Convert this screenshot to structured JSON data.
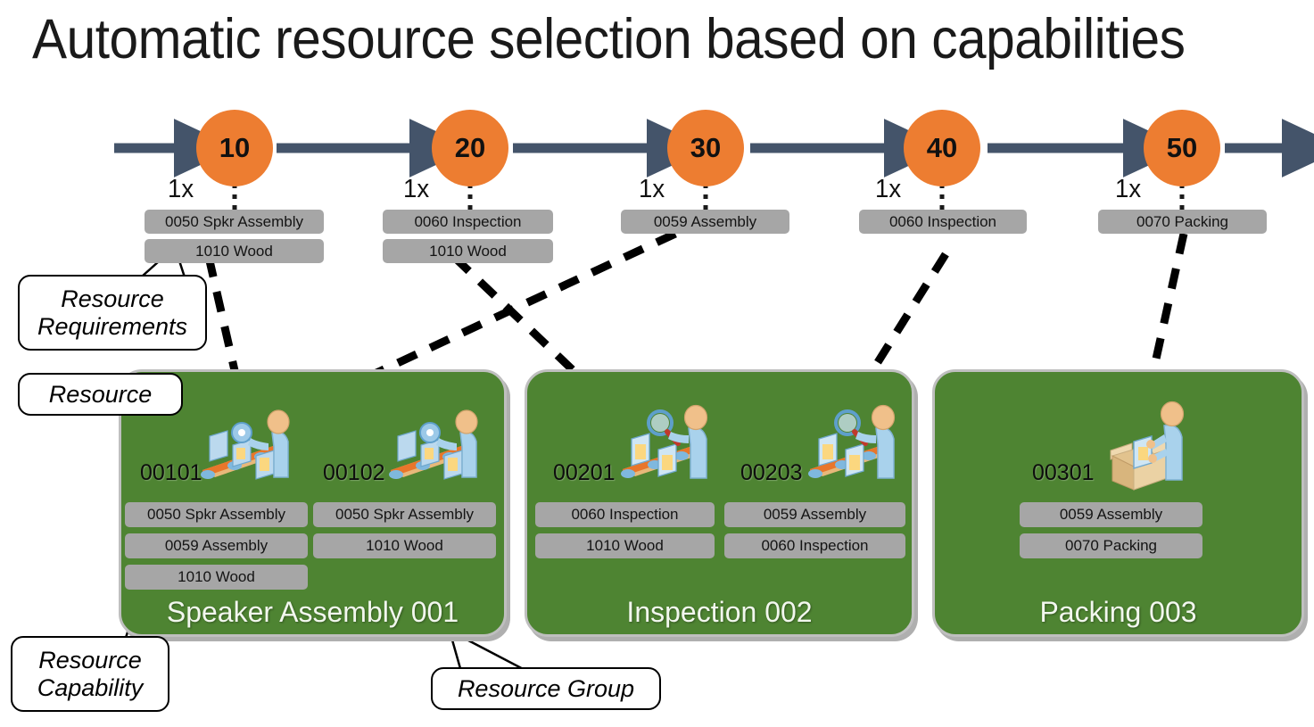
{
  "title": "Automatic resource selection based on capabilities",
  "colors": {
    "operation_node": "#ED7D31",
    "resource_group": "#4E8432",
    "capability_pill": "#A6A6A6",
    "arrow": "#44546A",
    "connector": "#000000"
  },
  "routing": {
    "operations": [
      {
        "number": "10",
        "multiplier": "1x",
        "requirements": [
          "0050 Spkr Assembly",
          "1010 Wood"
        ],
        "assigned_resource": "00101"
      },
      {
        "number": "20",
        "multiplier": "1x",
        "requirements": [
          "0060 Inspection",
          "1010 Wood"
        ],
        "assigned_resource": "00201"
      },
      {
        "number": "30",
        "multiplier": "1x",
        "requirements": [
          "0059 Assembly"
        ],
        "assigned_resource": "00102"
      },
      {
        "number": "40",
        "multiplier": "1x",
        "requirements": [
          "0060 Inspection"
        ],
        "assigned_resource": "00203"
      },
      {
        "number": "50",
        "multiplier": "1x",
        "requirements": [
          "0070 Packing"
        ],
        "assigned_resource": "00301"
      }
    ]
  },
  "resource_groups": [
    {
      "name": "Speaker Assembly 001",
      "icon": "assembly-worker-icon",
      "resources": [
        {
          "id": "00101",
          "icon": "assembly-worker-icon",
          "capabilities": [
            "0050 Spkr Assembly",
            "0059 Assembly",
            "1010 Wood"
          ]
        },
        {
          "id": "00102",
          "icon": "assembly-worker-icon",
          "capabilities": [
            "0050 Spkr Assembly",
            "1010 Wood"
          ]
        }
      ]
    },
    {
      "name": "Inspection 002",
      "icon": "inspection-worker-icon",
      "resources": [
        {
          "id": "00201",
          "icon": "inspection-worker-icon",
          "capabilities": [
            "0060 Inspection",
            "1010 Wood"
          ]
        },
        {
          "id": "00203",
          "icon": "inspection-worker-icon",
          "capabilities": [
            "0059 Assembly",
            "0060 Inspection"
          ]
        }
      ]
    },
    {
      "name": "Packing 003",
      "icon": "packing-worker-icon",
      "resources": [
        {
          "id": "00301",
          "icon": "packing-worker-icon",
          "capabilities": [
            "0059 Assembly",
            "0070 Packing"
          ]
        }
      ]
    }
  ],
  "callouts": {
    "resource_requirements": {
      "line1": "Resource",
      "line2": "Requirements"
    },
    "resource": {
      "line1": "Resource"
    },
    "resource_capability": {
      "line1": "Resource",
      "line2": "Capability"
    },
    "resource_group": {
      "line1": "Resource Group"
    }
  }
}
